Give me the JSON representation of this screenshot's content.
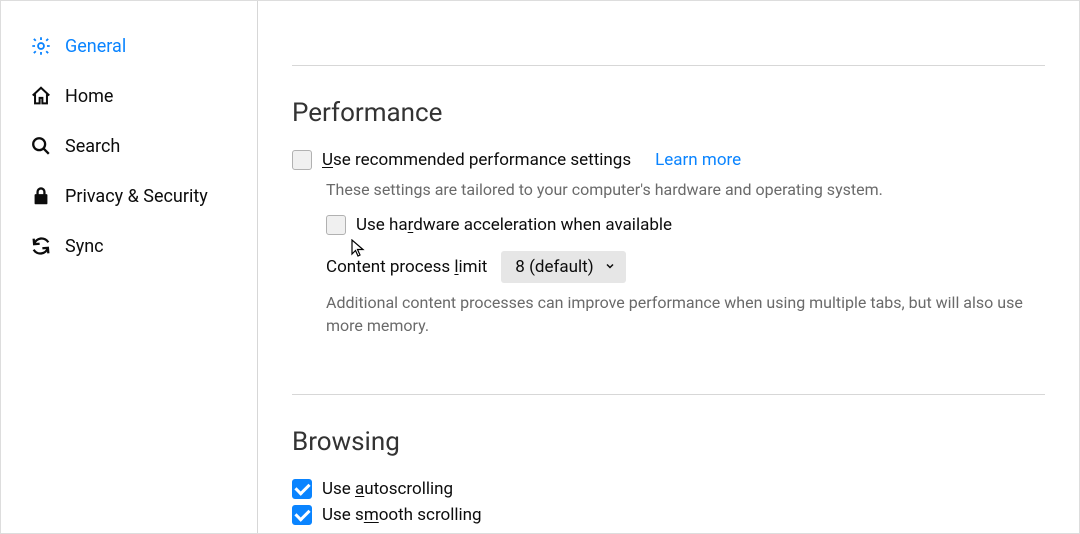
{
  "sidebar": {
    "items": [
      {
        "label": "General"
      },
      {
        "label": "Home"
      },
      {
        "label": "Search"
      },
      {
        "label": "Privacy & Security"
      },
      {
        "label": "Sync"
      }
    ]
  },
  "performance": {
    "title": "Performance",
    "recommended_pre": "U",
    "recommended_post": "se recommended performance settings",
    "learn_more": "Learn more",
    "tailored_text": "These settings are tailored to your computer's hardware and operating system.",
    "hw_pre": "Use ha",
    "hw_under": "r",
    "hw_post": "dware acceleration when available",
    "limit_pre": "Content process ",
    "limit_under": "l",
    "limit_post": "imit",
    "limit_value": "8 (default)",
    "additional_text": "Additional content processes can improve performance when using multiple tabs, but will also use more memory."
  },
  "browsing": {
    "title": "Browsing",
    "auto_pre": "Use ",
    "auto_under": "a",
    "auto_post": "utoscrolling",
    "smooth_pre": "Use s",
    "smooth_under": "m",
    "smooth_post": "ooth scrolling"
  }
}
